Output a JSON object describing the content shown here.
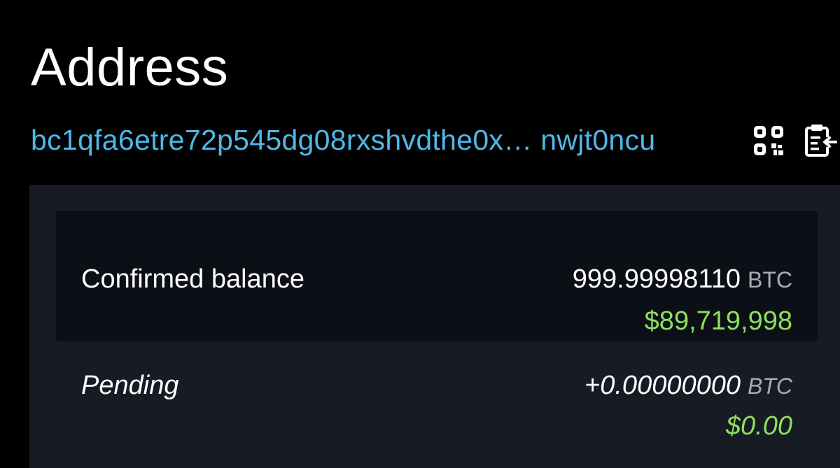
{
  "header": {
    "title": "Address"
  },
  "address": {
    "display": "bc1qfa6etre72p545dg08rxshvdthe0x… nwjt0ncu",
    "qr_icon": "qr-code-icon",
    "copy_icon": "clipboard-copy-icon"
  },
  "balances": {
    "confirmed": {
      "label": "Confirmed balance",
      "amount": "999.99998110",
      "unit": "BTC",
      "fiat": "$89,719,998"
    },
    "pending": {
      "label": "Pending",
      "amount": "+0.00000000",
      "unit": "BTC",
      "fiat": "$0.00"
    }
  },
  "colors": {
    "background": "#000000",
    "link": "#4fb8e8",
    "fiat": "#8fe05a",
    "panel": "#171b24",
    "card": "#0c0f16"
  }
}
